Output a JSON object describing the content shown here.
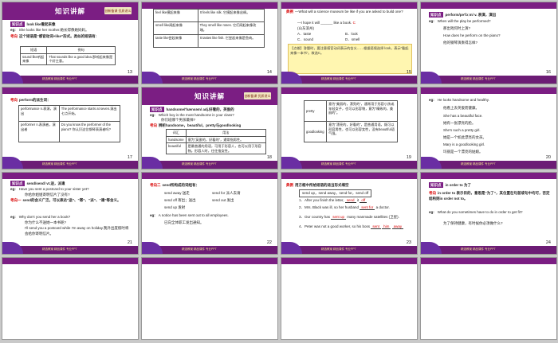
{
  "hdr_title": "知识讲解",
  "logo_text": "创新备课 优质讲义",
  "ftr_text": "精选教案 精品课件 专业PPT",
  "slides": {
    "s13": {
      "num": "13",
      "tag": "知识点",
      "head": "look like看起来像",
      "eg": "She looks like her mother.她长得像她妈妈。",
      "kp": "考向",
      "rule": "这个短语是“感官动词+like”形式。类似的短语有:",
      "th1": "短语",
      "th2": "例句",
      "r1c1": "sound like听起来像",
      "r1c2": "That sounds like a good idea.那听起来像是个好主意。"
    },
    "s14": {
      "num": "14",
      "r1c1": "feel like摸起来像",
      "r1c2": "It feels like silk. 它摸起来像丝绸。",
      "r2c1": "smell like闻起来像",
      "r2c2": "They smell like roses. 它们闻起来像玫瑰。",
      "r3c1": "taste like尝起来像",
      "r3c2": "It tastes like fish. 它尝起来像是鱼肉。"
    },
    "s15": {
      "num": "15",
      "label": "典例",
      "q1": "—What will a science museum be like if you are asked to build one?",
      "q2": "—I hope it will ______ like a book.",
      "ans": "C",
      "note": "(山东滨州)",
      "A": "A．taste",
      "B": "B．look",
      "C": "C．sound",
      "D": "D．smell",
      "expl": "【点拨】答题时，要注意感官动词表示的含义……根据语境选择 look，表示“看起来像一本书”。故选C。"
    },
    "s16": {
      "num": "16",
      "tag": "知识点",
      "head": "perform/pə'fɔːm/ v. 表演，演出",
      "eg": "When will the play be performed?",
      "eg_cn": "那出戏何时上演?",
      "eg2": "How does he perform on the piano?",
      "eg2_cn": "他的钢琴演奏得怎样?"
    },
    "s17": {
      "num": "17",
      "kp": "考向",
      "head": "perform的派生词：",
      "r1c1": "performance n.表演，演出",
      "r1c2": "The performance starts at seven.演出七点开始。",
      "r2c1": "performer n.表演者，演出者",
      "r2c2": "Do you know the performer of the piano? 你认识这位钢琴表演者吗?"
    },
    "s18": {
      "num": "18",
      "tag": "知识点",
      "head": "handsome/'hænsəm/ adj.好看的，英俊的",
      "eg": "Which boy is the most handsome in your class?",
      "eg_cn": "你们班哪个男孩最帅?",
      "kp": "考向",
      "rule": "辨析handsome，beautiful，pretty与goodlooking",
      "th1": "词汇",
      "th2": "用法",
      "r1c1": "handsome",
      "r1c2": "意为“英俊的，好看的”，通常指男性。",
      "r2c1": "beautiful",
      "r2c2": "是最普通的用语，可用于形容人，也可以用于形容物。形容人时，往往指女性。"
    },
    "s19": {
      "num": "19",
      "r1c1": "pretty",
      "r1c2": "意为“美丽的，漂亮的”，通常用于形容小孩或年轻女子，也可以形容物，意为“精致的，美丽的”。",
      "r2c1": "goodlooking",
      "r2c2": "意为“漂亮的，好看的”，是普通用语，既可以形容男性，也可以形容女性，没有beautiful语气强。"
    },
    "s20": {
      "num": "20",
      "eg": "He looks handsome and healthy.",
      "l1": "他看上去英俊而健康。",
      "l2": "She has a beautiful face.",
      "l3": "她有一张漂亮的脸。",
      "l4": "She's such a pretty girl.",
      "l5": "她是一个如此漂亮的女孩。",
      "l6": "Mary is a goodlooking girl.",
      "l7": "玛丽是一个漂亮的姑娘。"
    },
    "s21": {
      "num": "21",
      "tag": "知识点",
      "head": "send/send/ vt.送，派遣",
      "eg": "Have you sent a postcard to your sister yet?",
      "eg_cn": "你给你姐姐寄明信片了没有?",
      "kp": "考向一",
      "rule": "send的含义广泛，可以表达“送”、“寄”、“派”、“遣”等含义。",
      "eg2": "Why don't you send her a book?",
      "eg2_cn": "你为什么不送她一本书呢?",
      "eg3": "I'll send you a postcard while I'm away on holiday.我外出度假时将会给你寄明信片。"
    },
    "s22": {
      "num": "22",
      "kp": "考向二",
      "head": "send所构成的词组有：",
      "a1": "send away 送走",
      "a2": "send for 派人去请",
      "b1": "send off 寄出；送出",
      "b2": "send out 发出",
      "c1": "send up 发射",
      "eg": "A notice has been sent out to all employees.",
      "eg_cn": "已向全体职工发出通知。"
    },
    "s23": {
      "num": "23",
      "label": "典例",
      "task": "用方框中所给短语的适当形式填空",
      "opts": "send up，send away，send for，send off",
      "l1": "After you finish the letter, ",
      "a1": "send",
      "l1b": " it ",
      "a1b": "off",
      "l2": "Mrs. Black was ill, so her husband ",
      "a2": "sent for",
      "l2b": " a doctor.",
      "l3": "Our country has ",
      "a3": "sent up",
      "l3b": " many manmade satellites (卫星).",
      "l4": "Peter was not a good worker, so his boss ",
      "a4": "sent",
      "a4b": "him",
      "a4c": "away"
    },
    "s24": {
      "num": "24",
      "tag": "知识点",
      "head": "in order to 为了",
      "kp": "考向",
      "rule": "in order to 表示目的，意思是“为了”，其位置在句首或句中均可，否定结构则in order not to。",
      "eg": "What do you sometimes have to do in order to get fit?",
      "eg_cn": "为了保持健康，有时候你必须做什么?"
    }
  }
}
